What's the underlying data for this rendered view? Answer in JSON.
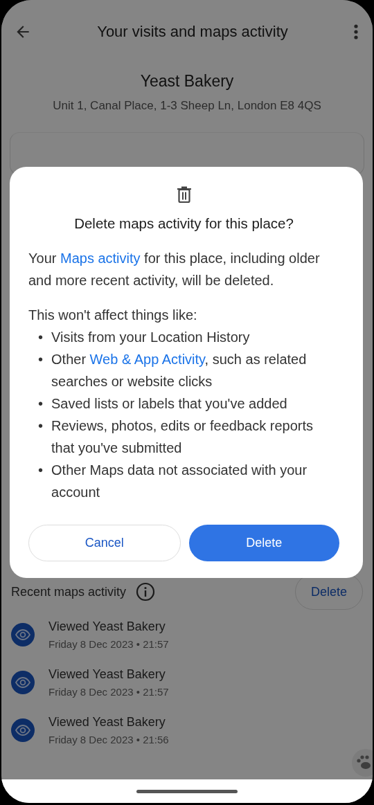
{
  "app_bar": {
    "title": "Your visits and maps activity"
  },
  "place": {
    "name": "Yeast Bakery",
    "address": "Unit 1, Canal Place, 1-3 Sheep Ln, London E8 4QS"
  },
  "recent": {
    "heading": "Recent maps activity",
    "delete_label": "Delete",
    "items": [
      {
        "title": "Viewed Yeast Bakery",
        "time": "Friday 8 Dec 2023 • 21:57"
      },
      {
        "title": "Viewed Yeast Bakery",
        "time": "Friday 8 Dec 2023 • 21:57"
      },
      {
        "title": "Viewed Yeast Bakery",
        "time": "Friday 8 Dec 2023 • 21:56"
      }
    ]
  },
  "dialog": {
    "title": "Delete maps activity for this place?",
    "intro": [
      {
        "kind": "text",
        "text": "Your "
      },
      {
        "kind": "link",
        "text": "Maps activity"
      },
      {
        "kind": "text",
        "text": " for this place, including older and more recent activity, will be deleted."
      }
    ],
    "list_heading": "This won't affect things like:",
    "bullets": [
      {
        "marker": "•",
        "parts": [
          {
            "kind": "text",
            "text": "Visits from your Location History"
          }
        ]
      },
      {
        "marker": "•",
        "parts": [
          {
            "kind": "text",
            "text": "Other "
          },
          {
            "kind": "link",
            "text": "Web & App Activity"
          },
          {
            "kind": "text",
            "text": ", such as related searches or website clicks"
          }
        ]
      },
      {
        "marker": "•",
        "parts": [
          {
            "kind": "text",
            "text": "Saved lists or labels that you've added"
          }
        ]
      },
      {
        "marker": "•",
        "parts": [
          {
            "kind": "text",
            "text": "Reviews, photos, edits or feedback reports that you've submitted"
          }
        ]
      },
      {
        "marker": "•",
        "parts": [
          {
            "kind": "text",
            "text": "Other Maps data not associated with your account"
          }
        ]
      }
    ],
    "cancel_label": "Cancel",
    "delete_label": "Delete"
  }
}
